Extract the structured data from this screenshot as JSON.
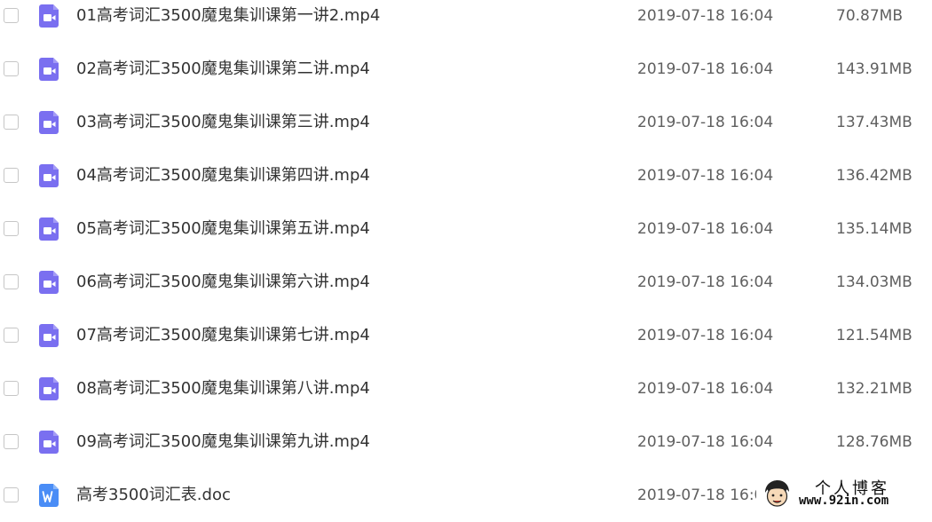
{
  "colors": {
    "video_icon": "#7a6ff0",
    "word_icon": "#4a8df6",
    "text": "#333333",
    "meta_text": "#5f5f5f"
  },
  "files": [
    {
      "name": "01高考词汇3500魔鬼集训课第一讲2.mp4",
      "date": "2019-07-18 16:04",
      "size": "70.87MB",
      "icon": "video-file-icon"
    },
    {
      "name": "02高考词汇3500魔鬼集训课第二讲.mp4",
      "date": "2019-07-18 16:04",
      "size": "143.91MB",
      "icon": "video-file-icon"
    },
    {
      "name": "03高考词汇3500魔鬼集训课第三讲.mp4",
      "date": "2019-07-18 16:04",
      "size": "137.43MB",
      "icon": "video-file-icon"
    },
    {
      "name": "04高考词汇3500魔鬼集训课第四讲.mp4",
      "date": "2019-07-18 16:04",
      "size": "136.42MB",
      "icon": "video-file-icon"
    },
    {
      "name": "05高考词汇3500魔鬼集训课第五讲.mp4",
      "date": "2019-07-18 16:04",
      "size": "135.14MB",
      "icon": "video-file-icon"
    },
    {
      "name": "06高考词汇3500魔鬼集训课第六讲.mp4",
      "date": "2019-07-18 16:04",
      "size": "134.03MB",
      "icon": "video-file-icon"
    },
    {
      "name": "07高考词汇3500魔鬼集训课第七讲.mp4",
      "date": "2019-07-18 16:04",
      "size": "121.54MB",
      "icon": "video-file-icon"
    },
    {
      "name": "08高考词汇3500魔鬼集训课第八讲.mp4",
      "date": "2019-07-18 16:04",
      "size": "132.21MB",
      "icon": "video-file-icon"
    },
    {
      "name": "09高考词汇3500魔鬼集训课第九讲.mp4",
      "date": "2019-07-18 16:04",
      "size": "128.76MB",
      "icon": "video-file-icon"
    },
    {
      "name": "高考3500词汇表.doc",
      "date": "2019-07-18 16:04",
      "size": "",
      "icon": "word-file-icon"
    }
  ],
  "watermark": {
    "title": "个人博客",
    "url": "www.92in.com"
  }
}
